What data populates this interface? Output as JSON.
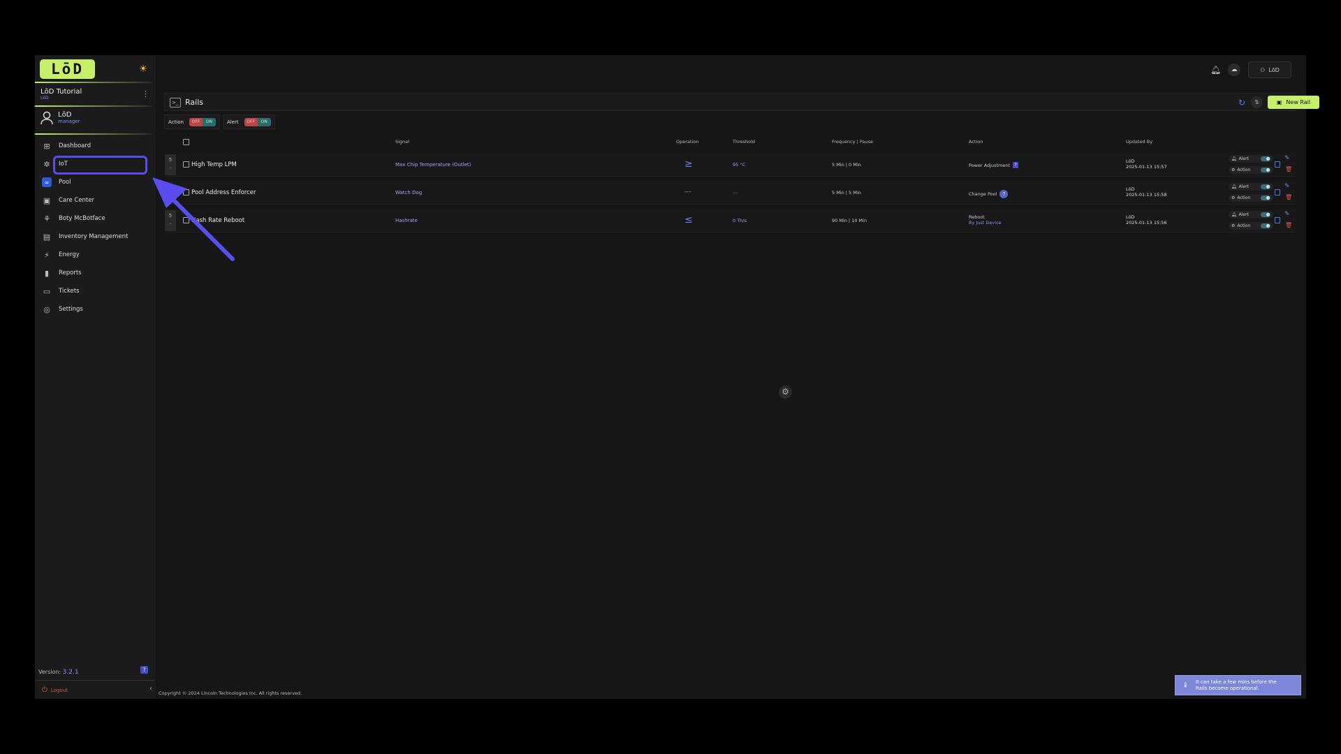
{
  "sidebar": {
    "logo_text": "LōD",
    "org_name": "LōD Tutorial",
    "org_sub": "LōD",
    "user_name": "LōD",
    "user_role": "manager",
    "items": [
      {
        "label": "Dashboard",
        "icon": "dashboard-icon"
      },
      {
        "label": "IoT",
        "icon": "iot-icon"
      },
      {
        "label": "Pool",
        "icon": "pool-icon"
      },
      {
        "label": "Care Center",
        "icon": "care-center-icon"
      },
      {
        "label": "Boty McBotface",
        "icon": "bot-icon"
      },
      {
        "label": "Inventory Management",
        "icon": "inventory-icon"
      },
      {
        "label": "Energy",
        "icon": "lightning-icon"
      },
      {
        "label": "Reports",
        "icon": "reports-icon"
      },
      {
        "label": "Tickets",
        "icon": "ticket-icon"
      },
      {
        "label": "Settings",
        "icon": "settings-icon"
      }
    ],
    "version_label": "Version:",
    "version_value": "3.2.1",
    "help_label": "?",
    "logout_label": "Logout"
  },
  "topbar": {
    "user_label": "LōD"
  },
  "panel": {
    "title": "Rails",
    "new_rail_label": "New Rail",
    "filters": [
      {
        "label": "Action",
        "off": "OFF",
        "on": "ON"
      },
      {
        "label": "Alert",
        "off": "OFF",
        "on": "ON"
      }
    ],
    "columns": {
      "signal": "Signal",
      "operation": "Operation",
      "threshold": "Threshold",
      "frequency": "Frequency | Pause",
      "action": "Action",
      "updated_by": "Updated By"
    },
    "rows": [
      {
        "priority": "5",
        "priority_sub": "-",
        "name": "High Temp LPM",
        "signal": "Max Chip Temperature (Outlet)",
        "operation": "≥",
        "threshold": "95 °C",
        "frequency": "5 Min | 0 Min",
        "action": "Power Adjustment",
        "action_help": "?",
        "action_sub": "",
        "updated_by": "LōD",
        "updated_at": "2025-01-13 15:57"
      },
      {
        "priority": "",
        "priority_sub": "",
        "name": "Pool Address Enforcer",
        "signal": "Watch Dog",
        "operation": "---",
        "threshold": "---",
        "frequency": "5 Min | 5 Min",
        "action": "Change Pool",
        "action_help": "?",
        "action_sub": "",
        "updated_by": "LōD",
        "updated_at": "2025-01-13 15:58"
      },
      {
        "priority": "5",
        "priority_sub": "-",
        "name": "Hash Rate Reboot",
        "signal": "Hashrate",
        "operation": "≤",
        "threshold": "0 Th/s",
        "frequency": "90 Min | 10 Min",
        "action": "Reboot",
        "action_help": "",
        "action_sub": "By Just Device",
        "updated_by": "LōD",
        "updated_at": "2025-01-13 15:56"
      }
    ],
    "row_toggles": {
      "alert": "Alert",
      "action": "Action"
    }
  },
  "footer": {
    "copyright": "Copyright © 2024 Lincoln Technologies Inc. All rights reserved."
  },
  "toast": {
    "icon": "info-icon",
    "line1": "It can take a few mins before the",
    "line2": "Rails become operational."
  },
  "colors": {
    "accent": "#c6f06a",
    "highlight": "#5b4cf0",
    "link": "#a9a2f7",
    "danger": "#e05252"
  }
}
